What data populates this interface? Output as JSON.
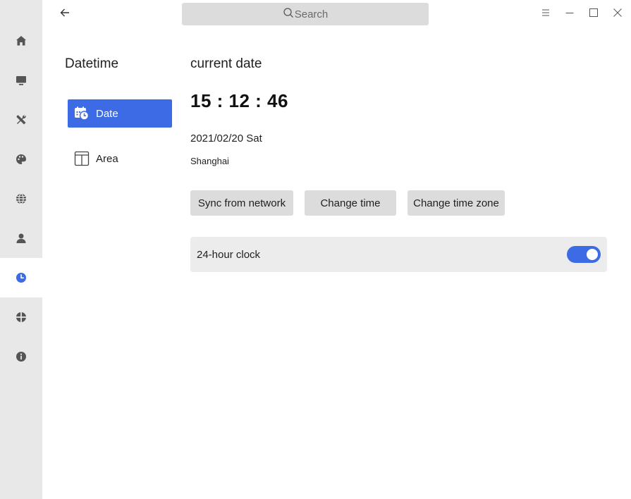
{
  "titlebar": {
    "search_placeholder": "Search"
  },
  "rail": {
    "items": [
      {
        "icon": "home-icon"
      },
      {
        "icon": "monitor-icon"
      },
      {
        "icon": "tools-icon"
      },
      {
        "icon": "palette-icon"
      },
      {
        "icon": "globe-icon"
      },
      {
        "icon": "user-icon"
      },
      {
        "icon": "clock-icon",
        "active": true
      },
      {
        "icon": "update-icon"
      },
      {
        "icon": "info-icon"
      }
    ]
  },
  "subnav": {
    "title": "Datetime",
    "items": [
      {
        "label": "Date",
        "icon": "calendar-clock-icon",
        "active": true
      },
      {
        "label": "Area",
        "icon": "area-layout-icon"
      }
    ]
  },
  "main": {
    "title": "current date",
    "time": "15 : 12 : 46",
    "date": "2021/02/20 Sat",
    "timezone": "Shanghai",
    "buttons": {
      "sync": "Sync from network",
      "change_time": "Change time",
      "change_zone": "Change time zone"
    },
    "clock_24h": {
      "label": "24-hour clock",
      "enabled": true
    }
  },
  "colors": {
    "accent": "#3d6be5",
    "rail_bg": "#e8e8e8",
    "button_bg": "#dcdcdc"
  }
}
